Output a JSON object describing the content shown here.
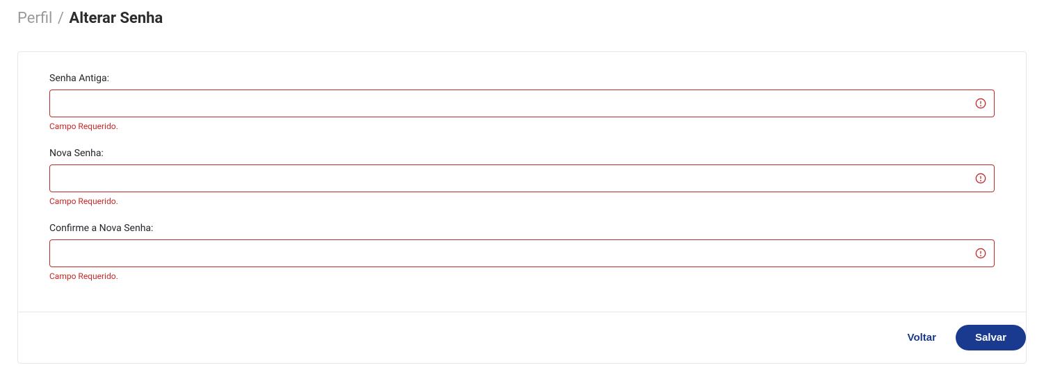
{
  "breadcrumb": {
    "parent": "Perfil",
    "separator": "/",
    "current": "Alterar Senha"
  },
  "form": {
    "fields": {
      "old_password": {
        "label": "Senha Antiga:",
        "value": "",
        "error": "Campo Requerido."
      },
      "new_password": {
        "label": "Nova Senha:",
        "value": "",
        "error": "Campo Requerido."
      },
      "confirm_password": {
        "label": "Confirme a Nova Senha:",
        "value": "",
        "error": "Campo Requerido."
      }
    }
  },
  "actions": {
    "back_label": "Voltar",
    "save_label": "Salvar"
  },
  "colors": {
    "error": "#c62828",
    "primary": "#1a3a8f"
  }
}
